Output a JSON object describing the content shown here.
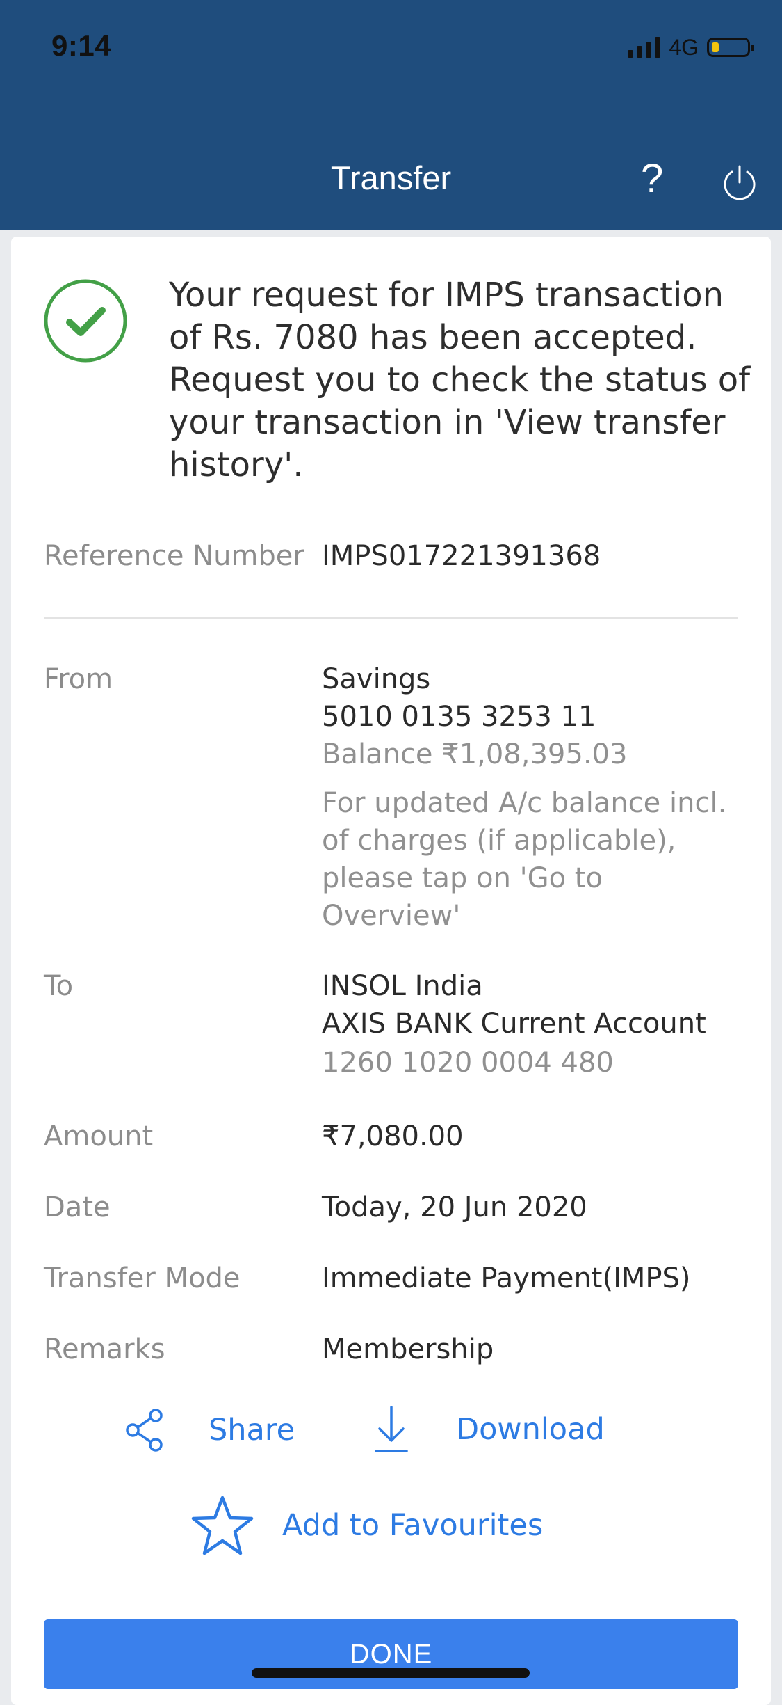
{
  "status_bar": {
    "time": "9:14",
    "network": "4G"
  },
  "header": {
    "title": "Transfer"
  },
  "confirmation": {
    "message": "Your request for IMPS transaction of Rs. 7080 has been accepted. Request you to check the status of your transaction in 'View transfer history'."
  },
  "details": {
    "reference": {
      "label": "Reference Number",
      "value": "IMPS017221391368"
    },
    "from": {
      "label": "From",
      "account_type": "Savings",
      "account_number": "5010 0135 3253 11",
      "balance": "Balance ₹1,08,395.03",
      "note": "For updated A/c balance incl. of charges (if applicable), please tap on 'Go to Overview'"
    },
    "to": {
      "label": "To",
      "name": "INSOL India",
      "bank": "AXIS BANK Current Account",
      "account_number": "1260 1020 0004 480"
    },
    "amount": {
      "label": "Amount",
      "value": "₹7,080.00"
    },
    "date": {
      "label": "Date",
      "value": "Today, 20 Jun 2020"
    },
    "mode": {
      "label": "Transfer Mode",
      "value": "Immediate Payment(IMPS)"
    },
    "remarks": {
      "label": "Remarks",
      "value": "Membership"
    }
  },
  "actions": {
    "share_label": "Share",
    "download_label": "Download",
    "favourite_label": "Add to Favourites",
    "done_label": "DONE"
  },
  "icons": {
    "signal": "cellular-signal-icon",
    "battery": "battery-icon",
    "help": "question-mark-icon",
    "power": "power-icon",
    "success": "checkmark-circle-icon",
    "share": "share-icon",
    "download": "download-icon",
    "favourite": "star-icon"
  },
  "colors": {
    "header_bg": "#1f4d7d",
    "accent_blue": "#2d7be3",
    "done_button": "#3a80ec",
    "success_green": "#43a047",
    "battery_fill": "#f2c40f"
  }
}
